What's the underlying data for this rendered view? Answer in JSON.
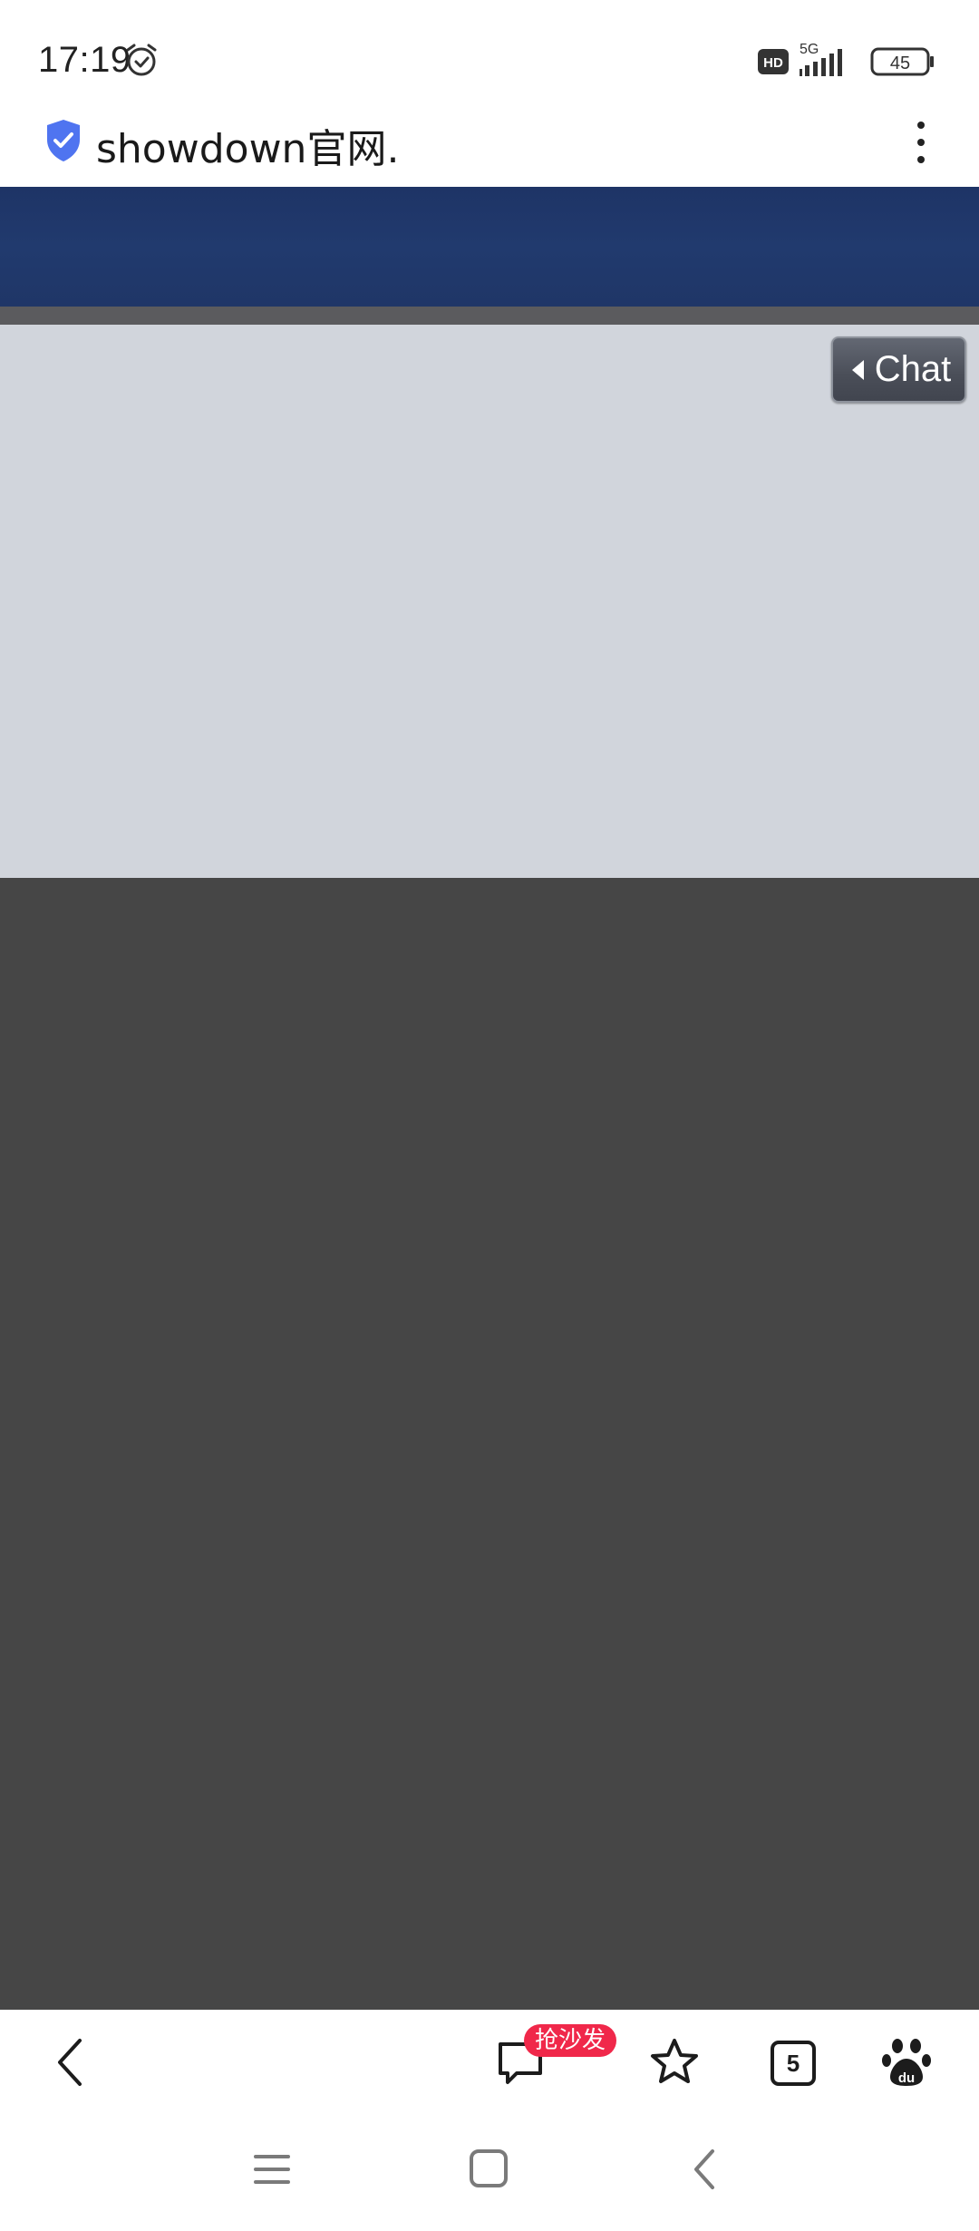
{
  "status_bar": {
    "time": "17:19",
    "network": "5G",
    "hd_label": "HD",
    "battery_level": "45",
    "icons": [
      "alarm-icon",
      "hd-icon",
      "signal-icon",
      "battery-icon"
    ]
  },
  "browser": {
    "url_text": "showdown官网.",
    "security_icon": "shield-check-icon",
    "menu_icon": "more-vertical-icon"
  },
  "page": {
    "chat_button_label": "Chat",
    "colors": {
      "banner": "#1f3667",
      "content": "#d1d5dc",
      "dark": "#464646"
    }
  },
  "toolbar": {
    "back_icon": "back-arrow-icon",
    "comment_badge": "抢沙发",
    "tab_count": "5",
    "items": [
      "back-icon",
      "comment-icon",
      "star-icon",
      "tabs-icon",
      "baidu-paw-icon"
    ]
  },
  "nav_bar": {
    "items": [
      "menu-nav",
      "home-nav",
      "back-nav"
    ]
  }
}
